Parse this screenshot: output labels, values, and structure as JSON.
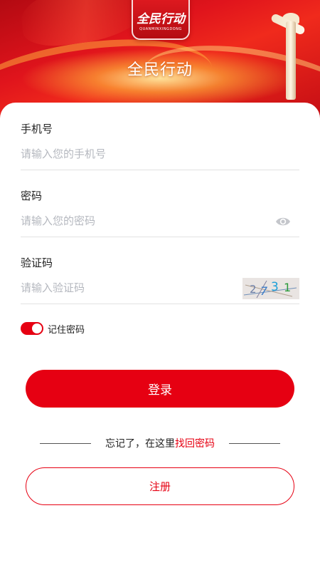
{
  "header": {
    "logo_text": "全民行动",
    "logo_subtext": "QUANMINXINGDONG",
    "title": "全民行动"
  },
  "form": {
    "phone": {
      "label": "手机号",
      "placeholder": "请输入您的手机号",
      "value": ""
    },
    "password": {
      "label": "密码",
      "placeholder": "请输入您的密码",
      "value": "",
      "icon": "eye-icon"
    },
    "captcha": {
      "label": "验证码",
      "placeholder": "请输入验证码",
      "value": "",
      "image_text": "2731"
    },
    "remember": {
      "label": "记住密码",
      "checked": true
    }
  },
  "actions": {
    "login_label": "登录",
    "forgot_prefix": "忘记了，在这里",
    "forgot_link": "找回密码",
    "register_label": "注册"
  },
  "colors": {
    "accent": "#e60012",
    "placeholder": "#b5b8bf"
  }
}
